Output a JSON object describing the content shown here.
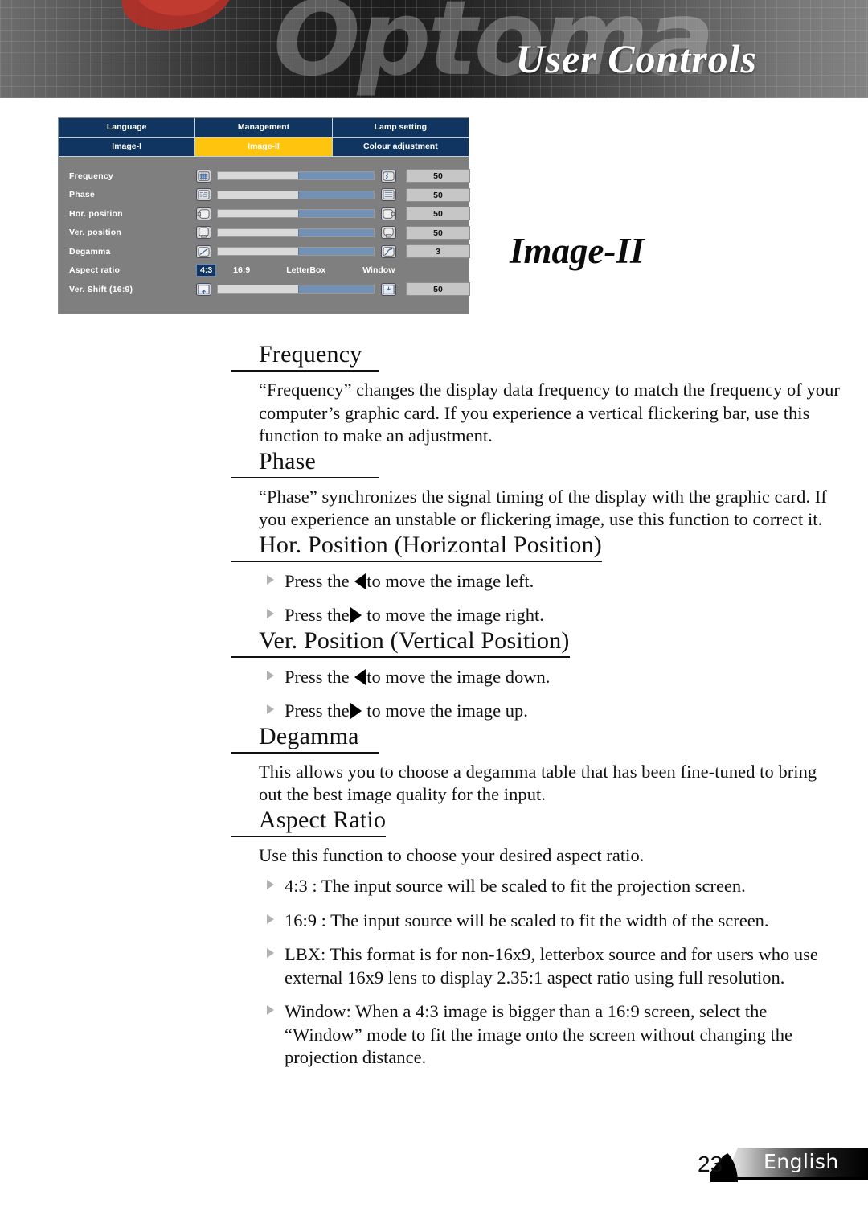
{
  "banner": {
    "brand": "Optoma",
    "title": "User Controls"
  },
  "osd": {
    "tabs_row1": [
      {
        "label": "Language",
        "active": false
      },
      {
        "label": "Management",
        "active": false
      },
      {
        "label": "Lamp setting",
        "active": false
      }
    ],
    "tabs_row2": [
      {
        "label": "Image-I",
        "active": false
      },
      {
        "label": "Image-II",
        "active": true
      },
      {
        "label": "Colour adjustment",
        "active": false
      }
    ],
    "rows": [
      {
        "label": "Frequency",
        "value": "50",
        "fill_pct": 52,
        "icon_left": "frequency-pattern-icon",
        "icon_right": "frequency-wave-icon"
      },
      {
        "label": "Phase",
        "value": "50",
        "fill_pct": 52,
        "icon_left": "phase-noise-icon",
        "icon_right": "phase-clear-icon"
      },
      {
        "label": "Hor. position",
        "value": "50",
        "fill_pct": 52,
        "icon_left": "shift-left-icon",
        "icon_right": "shift-right-icon"
      },
      {
        "label": "Ver. position",
        "value": "50",
        "fill_pct": 52,
        "icon_left": "shift-up-icon",
        "icon_right": "shift-down-icon"
      },
      {
        "label": "Degamma",
        "value": "3",
        "fill_pct": 52,
        "icon_left": "gamma-linear-icon",
        "icon_right": "gamma-curve-icon"
      }
    ],
    "aspect_row": {
      "label": "Aspect ratio",
      "options": [
        {
          "label": "4:3",
          "selected": true
        },
        {
          "label": "16:9",
          "selected": false
        },
        {
          "label": "LetterBox",
          "selected": false
        },
        {
          "label": "Window",
          "selected": false
        }
      ]
    },
    "vshift_row": {
      "label": "Ver. Shift (16:9)",
      "value": "50",
      "fill_pct": 52,
      "icon_left": "vshift-up-icon",
      "icon_right": "vshift-screen-icon"
    },
    "colors": {
      "tab_bg": "#0f3560",
      "tab_active_bg": "#ffc40d",
      "panel_bg": "#7f7f7f",
      "slider_fill": "#7391b4",
      "slider_track": "#d9d9d9"
    }
  },
  "page": {
    "heading": "Image-II",
    "sections": [
      {
        "title": "Frequency",
        "body": "“Frequency” changes the display data frequency to match the frequency of your computer’s graphic card. If you experience a vertical flickering bar, use this function to make an adjustment."
      },
      {
        "title": "Phase",
        "body": "“Phase” synchronizes the signal timing of the display with the graphic card. If you experience an unstable or flickering image, use this function to correct it."
      },
      {
        "title": "Hor. Position (Horizontal Position)",
        "bullets": [
          {
            "pre": "Press the ",
            "arrow": "left",
            "post": "to move the image left."
          },
          {
            "pre": "Press the",
            "arrow": "right",
            "post": " to move the image right."
          }
        ]
      },
      {
        "title": "Ver. Position (Vertical Position)",
        "bullets": [
          {
            "pre": "Press the ",
            "arrow": "left",
            "post": "to move the image down."
          },
          {
            "pre": "Press the",
            "arrow": "right",
            "post": " to move the image up."
          }
        ]
      },
      {
        "title": "Degamma",
        "body": "This allows you to choose a degamma table that has been fine-tuned to bring out the best image quality for the input."
      },
      {
        "title": "Aspect Ratio",
        "body": "Use this function to choose your desired aspect ratio.",
        "bullets_plain": [
          "4:3 : The input source will be scaled to fit the projection screen.",
          "16:9 : The input source will be scaled to fit the width of the screen.",
          "LBX: This format is for non-16x9, letterbox source and for users who use external 16x9 lens to display 2.35:1 aspect ratio using full resolution.",
          "Window: When a 4:3 image is bigger than a 16:9 screen, select the “Window” mode to fit the image onto the screen without changing the projection distance."
        ]
      }
    ]
  },
  "footer": {
    "page_number": "23",
    "language": "English"
  }
}
